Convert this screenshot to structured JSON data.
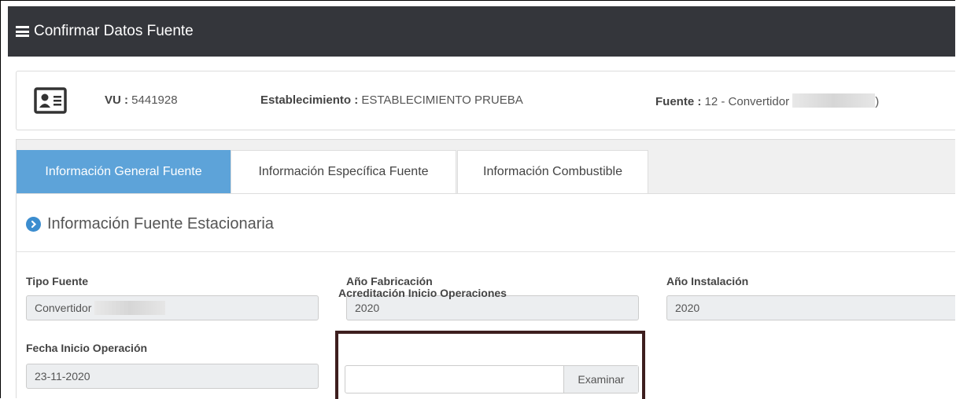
{
  "header": {
    "title": "Confirmar Datos Fuente"
  },
  "info": {
    "vu_label": "VU :",
    "vu_value": "5441928",
    "est_label": "Establecimiento :",
    "est_value": "ESTABLECIMIENTO PRUEBA",
    "fuente_label": "Fuente :",
    "fuente_value": "12 - Convertidor",
    "fuente_suffix": ")"
  },
  "tabs": [
    {
      "label": "Información General Fuente",
      "active": true
    },
    {
      "label": "Información Específica Fuente",
      "active": false
    },
    {
      "label": "Información Combustible",
      "active": false
    }
  ],
  "section": {
    "title": "Información Fuente Estacionaria"
  },
  "fields": {
    "tipo_fuente": {
      "label": "Tipo Fuente",
      "value": "Convertidor"
    },
    "anio_fabricacion": {
      "label": "Año Fabricación",
      "value": "2020"
    },
    "anio_instalacion": {
      "label": "Año Instalación",
      "value": "2020"
    },
    "fecha_inicio": {
      "label": "Fecha Inicio Operación",
      "value": "23-11-2020"
    },
    "acreditacion": {
      "label": "Acreditación Inicio Operaciones",
      "value": "",
      "button": "Examinar"
    }
  },
  "colors": {
    "header_bg": "#34363b",
    "tab_active": "#5da3d9",
    "accent": "#3c8dcf",
    "highlight_border": "#3d1e1e"
  }
}
